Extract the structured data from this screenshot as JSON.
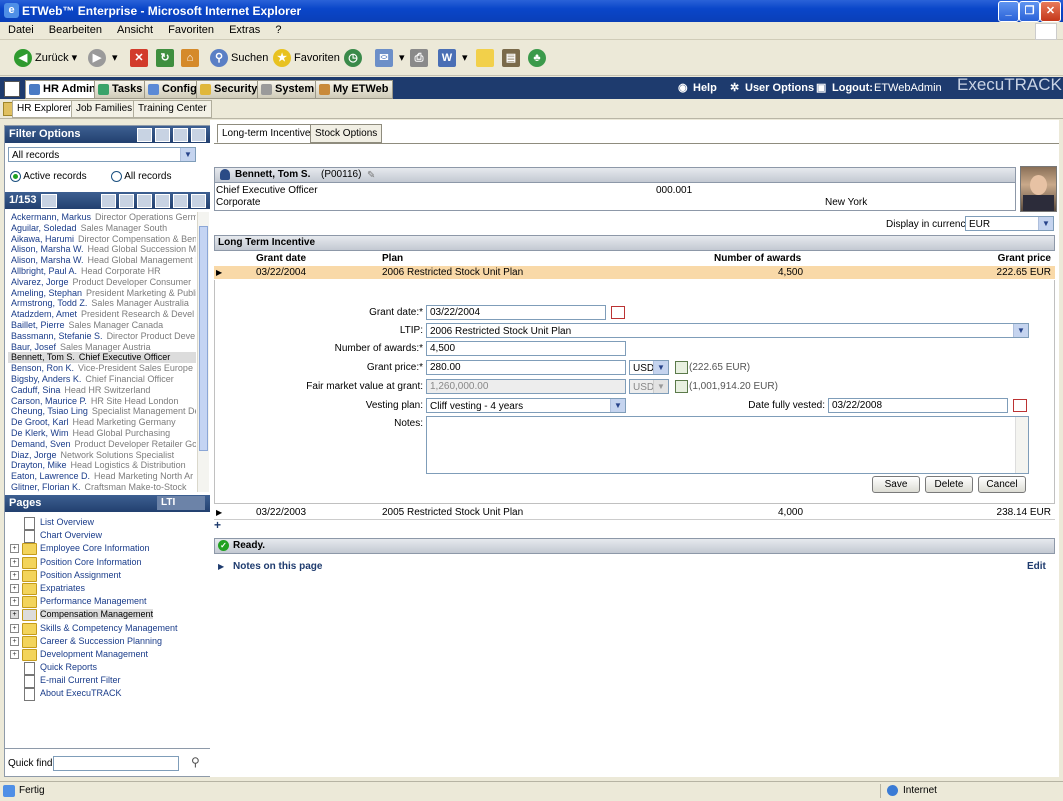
{
  "window": {
    "title": "ETWeb™ Enterprise - Microsoft Internet Explorer"
  },
  "menu": [
    "Datei",
    "Bearbeiten",
    "Ansicht",
    "Favoriten",
    "Extras",
    "?"
  ],
  "ie_toolbar": {
    "back": "Zurück",
    "search": "Suchen",
    "favorites": "Favoriten"
  },
  "app_tabs": [
    {
      "label": "HR Admin"
    },
    {
      "label": "Tasks"
    },
    {
      "label": "Config"
    },
    {
      "label": "Security"
    },
    {
      "label": "System"
    },
    {
      "label": "My ETWeb"
    }
  ],
  "top_links": {
    "help": "Help",
    "user_options": "User Options",
    "logout": "Logout:",
    "user": "ETWebAdmin",
    "logo": "ExecuTRACK"
  },
  "sub_tabs": [
    "HR Explorer",
    "Job Families",
    "Training Center"
  ],
  "filter": {
    "header": "Filter Options",
    "selected": "All records",
    "radio_active": "Active records",
    "radio_all": "All records",
    "counter": "1/153"
  },
  "employees": [
    {
      "name": "Ackermann, Markus",
      "role": "Director Operations Germ"
    },
    {
      "name": "Aguilar, Soledad",
      "role": "Sales Manager South"
    },
    {
      "name": "Aikawa, Harumi",
      "role": "Director Compensation & Ben"
    },
    {
      "name": "Alison, Marsha W.",
      "role": "Head Global Succession Ma"
    },
    {
      "name": "Alison, Marsha W.",
      "role": "Head Global Management I"
    },
    {
      "name": "Allbright, Paul A.",
      "role": "Head Corporate HR"
    },
    {
      "name": "Alvarez, Jorge",
      "role": "Product Developer Consumer"
    },
    {
      "name": "Ameling, Stephan",
      "role": "President Marketing & Publi"
    },
    {
      "name": "Armstrong, Todd Z.",
      "role": "Sales Manager Australia"
    },
    {
      "name": "Atadzdem, Amet",
      "role": "President Research & Devel"
    },
    {
      "name": "Baillet, Pierre",
      "role": "Sales Manager Canada"
    },
    {
      "name": "Bassmann, Stefanie S.",
      "role": "Director Product Deve"
    },
    {
      "name": "Baur, Josef",
      "role": "Sales Manager Austria"
    },
    {
      "name": "Bennett, Tom S.",
      "role": "Chief Executive Officer"
    },
    {
      "name": "Benson, Ron K.",
      "role": "Vice-President Sales Europe"
    },
    {
      "name": "Bigsby, Anders K.",
      "role": "Chief Financial Officer"
    },
    {
      "name": "Caduff, Sina",
      "role": "Head HR Switzerland"
    },
    {
      "name": "Carson, Maurice P.",
      "role": "HR Site Head London"
    },
    {
      "name": "Cheung, Tsiao Ling",
      "role": "Specialist Management De"
    },
    {
      "name": "De Groot, Karl",
      "role": "Head Marketing Germany"
    },
    {
      "name": "De Klerk, Wim",
      "role": "Head Global Purchasing"
    },
    {
      "name": "Demand, Sven",
      "role": "Product Developer Retailer Gc"
    },
    {
      "name": "Diaz, Jorge",
      "role": "Network Solutions Specialist"
    },
    {
      "name": "Drayton, Mike",
      "role": "Head Logistics & Distribution"
    },
    {
      "name": "Eaton, Lawrence D.",
      "role": "Head Marketing North Ar"
    },
    {
      "name": "Glitner, Florian K.",
      "role": "Craftsman Make-to-Stock"
    }
  ],
  "pages": {
    "header": "Pages",
    "badge": "LTI",
    "items": [
      {
        "label": "List Overview",
        "type": "doc"
      },
      {
        "label": "Chart Overview",
        "type": "doc"
      },
      {
        "label": "Employee Core Information",
        "type": "folder"
      },
      {
        "label": "Position Core Information",
        "type": "folder"
      },
      {
        "label": "Position Assignment",
        "type": "folder"
      },
      {
        "label": "Expatriates",
        "type": "folder"
      },
      {
        "label": "Performance Management",
        "type": "folder"
      },
      {
        "label": "Compensation Management",
        "type": "folder"
      },
      {
        "label": "Skills & Competency Management",
        "type": "folder"
      },
      {
        "label": "Career & Succession Planning",
        "type": "folder"
      },
      {
        "label": "Development Management",
        "type": "folder"
      },
      {
        "label": "Quick Reports",
        "type": "doc"
      },
      {
        "label": "E-mail Current Filter",
        "type": "doc"
      },
      {
        "label": "About ExecuTRACK",
        "type": "doc"
      }
    ]
  },
  "quickfind": {
    "label": "Quick find:"
  },
  "main_tabs": [
    "Long-term Incentives",
    "Stock Options"
  ],
  "employee": {
    "name": "Bennett, Tom S.",
    "id": "(P00116)",
    "title": "Chief Executive Officer",
    "unit": "Corporate",
    "code": "000.001",
    "location": "New York"
  },
  "currency": {
    "label": "Display in currency:",
    "value": "EUR"
  },
  "lti": {
    "header": "Long Term Incentive",
    "columns": {
      "grant_date": "Grant date",
      "plan": "Plan",
      "awards": "Number of awards",
      "price": "Grant price"
    },
    "rows": [
      {
        "date": "03/22/2004",
        "plan": "2006 Restricted Stock Unit Plan",
        "awards": "4,500",
        "price": "222.65 EUR"
      },
      {
        "date": "03/22/2003",
        "plan": "2005 Restricted Stock Unit Plan",
        "awards": "4,000",
        "price": "238.14 EUR"
      }
    ]
  },
  "form": {
    "grant_date_label": "Grant date:*",
    "grant_date": "03/22/2004",
    "ltip_label": "LTIP:",
    "ltip": "2006 Restricted Stock Unit Plan",
    "awards_label": "Number of awards:*",
    "awards": "4,500",
    "price_label": "Grant price:*",
    "price": "280.00",
    "price_currency": "USD",
    "price_converted": "(222.65 EUR)",
    "fmv_label": "Fair market value at grant:",
    "fmv": "1,260,000.00",
    "fmv_currency": "USD",
    "fmv_converted": "(1,001,914.20 EUR)",
    "vesting_label": "Vesting plan:",
    "vesting": "Cliff vesting - 4 years",
    "vested_label": "Date fully vested:",
    "vested": "03/22/2008",
    "notes_label": "Notes:",
    "save": "Save",
    "delete": "Delete",
    "cancel": "Cancel"
  },
  "add_symbol": "+",
  "status_ready": "Ready.",
  "notes_link": "Notes on this page",
  "edit_link": "Edit",
  "statusbar": {
    "left": "Fertig",
    "right": "Internet"
  },
  "colors": {
    "accent": "#1e3b6e",
    "selected_row": "#f9d9a8",
    "ready_green": "#21a121"
  }
}
